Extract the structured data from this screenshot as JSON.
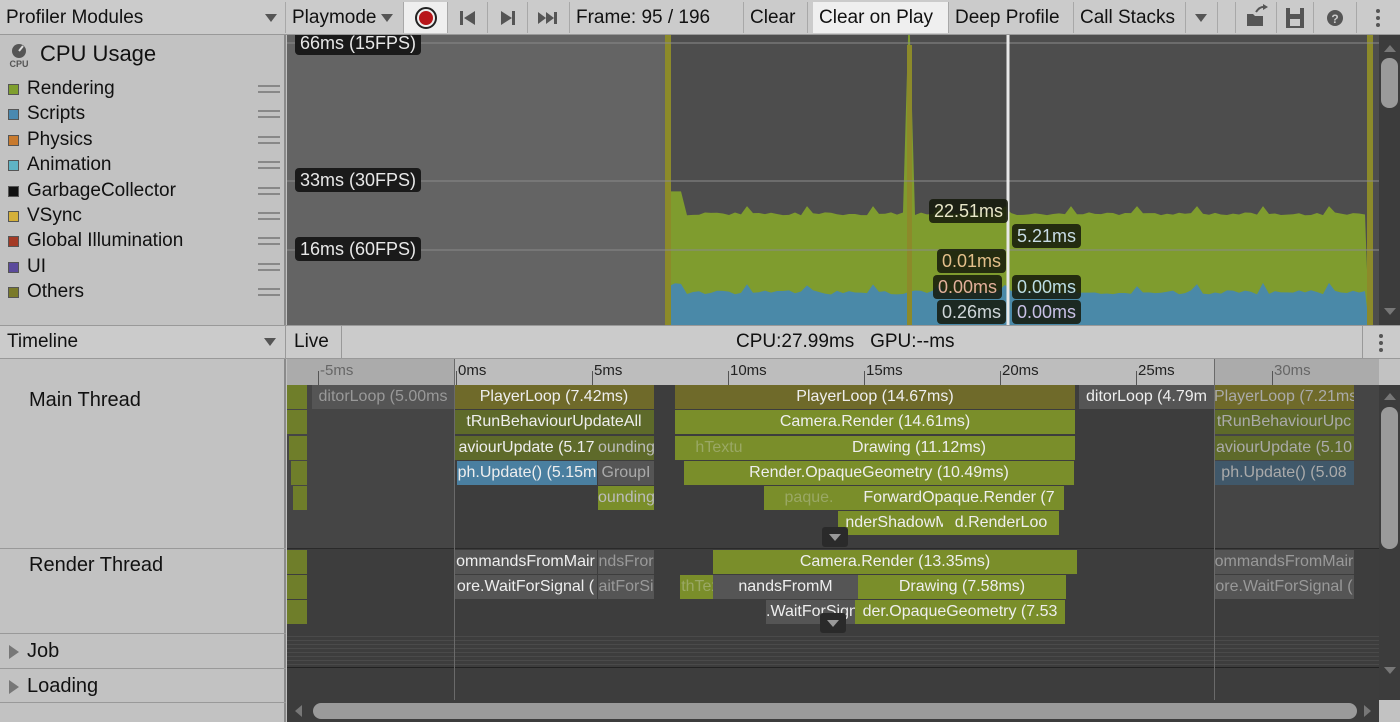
{
  "toolbar": {
    "modules_dropdown": "Profiler Modules",
    "target_dropdown": "Playmode",
    "frame_label": "Frame: 95 / 196",
    "clear": "Clear",
    "clear_on_play": "Clear on Play",
    "deep_profile": "Deep Profile",
    "call_stacks": "Call Stacks",
    "icons": [
      "record-icon",
      "first-frame-icon",
      "next-frame-icon",
      "last-frame-icon",
      "load-icon",
      "save-icon",
      "help-icon",
      "more-icon"
    ]
  },
  "module": {
    "title": "CPU Usage",
    "icon_text": "CPU",
    "legend": [
      {
        "label": "Rendering",
        "color": "#7f9f2e"
      },
      {
        "label": "Scripts",
        "color": "#4a89b0"
      },
      {
        "label": "Physics",
        "color": "#c87a2e"
      },
      {
        "label": "Animation",
        "color": "#5fb3c4"
      },
      {
        "label": "GarbageCollector",
        "color": "#111111"
      },
      {
        "label": "VSync",
        "color": "#d4b03a"
      },
      {
        "label": "Global Illumination",
        "color": "#a33a25"
      },
      {
        "label": "UI",
        "color": "#5b4a9c"
      },
      {
        "label": "Others",
        "color": "#7a7a2a"
      }
    ]
  },
  "chart_data": {
    "type": "area",
    "title": "CPU Usage",
    "frame_selected": 95,
    "frame_total": 196,
    "reference_lines": [
      {
        "label": "66ms (15FPS)",
        "value": 66
      },
      {
        "label": "33ms (30FPS)",
        "value": 33
      },
      {
        "label": "16ms (60FPS)",
        "value": 16
      }
    ],
    "ylim": [
      0,
      70
    ],
    "series": [
      {
        "name": "Rendering",
        "typical_ms": 22.5
      },
      {
        "name": "Scripts",
        "typical_ms": 5.2
      },
      {
        "name": "Others",
        "typical_ms": 0.26
      }
    ],
    "selected_values_left": [
      "22.51ms",
      "0.01ms",
      "0.00ms",
      "0.26ms"
    ],
    "selected_values_right": [
      "5.21ms",
      "0.00ms",
      "0.00ms"
    ]
  },
  "timeline": {
    "view_dropdown": "Timeline",
    "live": "Live",
    "stats": "CPU:27.99ms   GPU:--ms",
    "ticks": [
      "-5ms",
      "0ms",
      "5ms",
      "10ms",
      "15ms",
      "20ms",
      "25ms",
      "30ms"
    ],
    "threads": [
      {
        "name": "Main Thread"
      },
      {
        "name": "Render Thread"
      }
    ],
    "groups": [
      {
        "name": "Job"
      },
      {
        "name": "Loading"
      }
    ],
    "main_bars": [
      "ditorLoop (5.00ms",
      "PlayerLoop (7.42ms)",
      "tRunBehaviourUpdateAll",
      "aviourUpdate (5.17",
      "ounding",
      "ph.Update() (5.15m",
      "GroupI",
      "ounding",
      "PlayerLoop (14.67ms)",
      "Camera.Render (14.61ms)",
      "hTextu",
      "Drawing (11.12ms)",
      "Render.OpaqueGeometry (10.49ms)",
      "paque.",
      "ForwardOpaque.Render (7",
      "nderShadowM",
      "d.RenderLoo",
      "ditorLoop (4.79m",
      "PlayerLoop (7.21ms)",
      "tRunBehaviourUpc",
      "aviourUpdate (5.10",
      "ph.Update() (5.08"
    ],
    "render_bars": [
      "ommandsFromMair",
      "ndsFror",
      "ore.WaitForSignal (",
      "aitForSi",
      "Camera.Render (13.35ms)",
      "thTextu",
      "nandsFromM",
      "Drawing (7.58ms)",
      ".WaitForSign",
      "der.OpaqueGeometry (7.53",
      "ommandsFromMair",
      "ore.WaitForSignal ("
    ]
  }
}
